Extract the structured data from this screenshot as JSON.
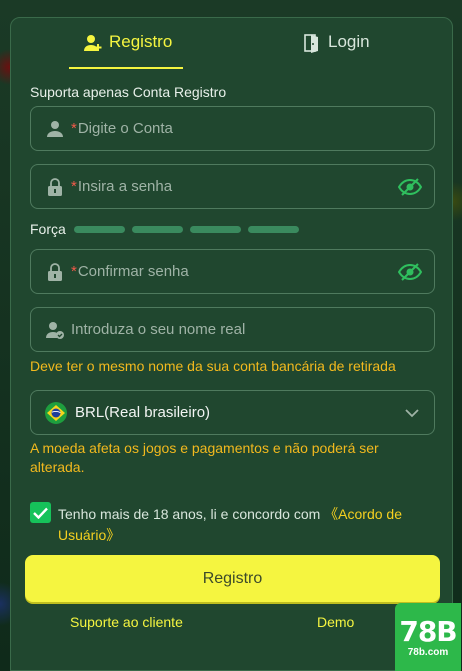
{
  "tabs": {
    "register": "Registro",
    "login": "Login"
  },
  "form": {
    "support_note": "Suporta apenas Conta Registro",
    "account": {
      "required_mark": "*",
      "placeholder": "Digite o Conta"
    },
    "password": {
      "required_mark": "*",
      "placeholder": "Insira a senha"
    },
    "strength_label": "Força",
    "strength_segments": 4,
    "confirm": {
      "required_mark": "*",
      "placeholder": "Confirmar senha"
    },
    "realname": {
      "placeholder": "Introduza o seu nome real"
    },
    "realname_hint": "Deve ter o mesmo nome da sua conta bancária de retirada",
    "currency": {
      "value": "BRL(Real brasileiro)"
    },
    "currency_hint": "A moeda afeta os jogos e pagamentos e não poderá ser alterada.",
    "agree": {
      "checked": true,
      "text": "Tenho mais de 18 anos, li e concordo com ",
      "link": "《Acordo de Usuário》"
    },
    "submit_label": "Registro"
  },
  "footer": {
    "support": "Suporte ao cliente",
    "demo": "Demo"
  },
  "watermark": {
    "big": "78B",
    "small": "78b.com"
  },
  "colors": {
    "accent": "#f5f540",
    "panel": "#20472f",
    "warning": "#f2b91e",
    "required": "#f25a4a",
    "check": "#16c25a"
  }
}
